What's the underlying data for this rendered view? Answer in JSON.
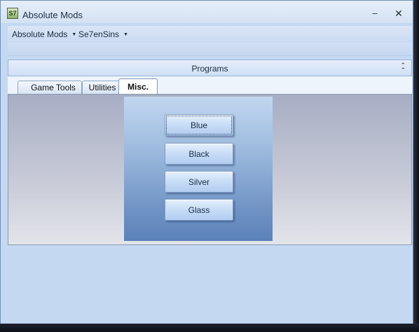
{
  "window": {
    "title": "Absolute Mods",
    "icon": "app-logo-icon",
    "icon_glyph": "S7",
    "minimize_glyph": "–",
    "close_glyph": "✕"
  },
  "menu": [
    {
      "label": "Absolute Mods",
      "arrow": "▼"
    },
    {
      "label": "Se7enSins",
      "arrow": "▼"
    }
  ],
  "panel": {
    "title": "Programs",
    "collapse_glyph": "⌃\n⌃"
  },
  "tabs": [
    {
      "label": "Game Tools",
      "selected": false
    },
    {
      "label": "Utilities",
      "selected": false
    },
    {
      "label": "Misc.",
      "selected": true
    }
  ],
  "theme_buttons": [
    "Blue",
    "Black",
    "Silver",
    "Glass"
  ],
  "colors": {
    "window_bg": "#c4d8f2",
    "panel_gradient_top": "#c1d7f0",
    "panel_gradient_bottom": "#5a82ba"
  }
}
